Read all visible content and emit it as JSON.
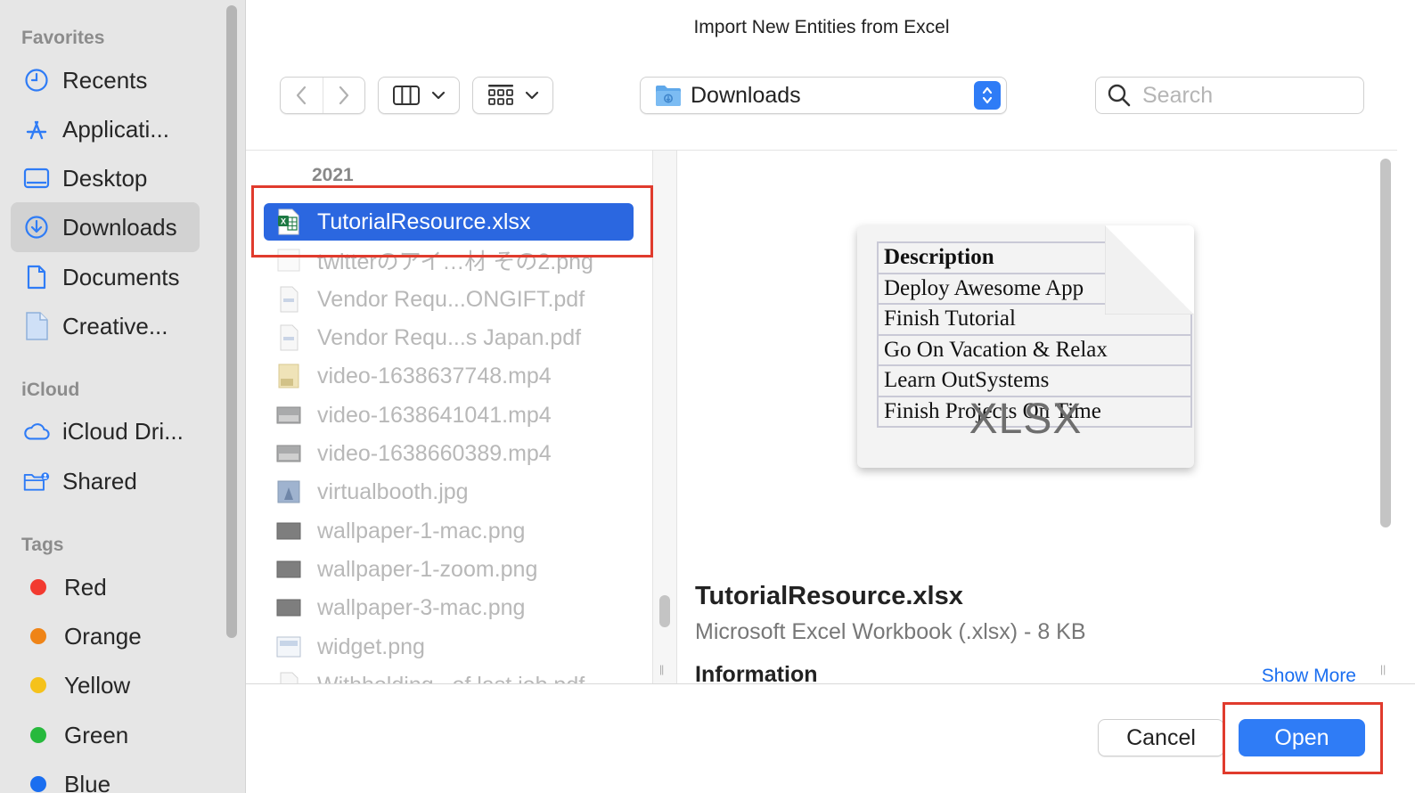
{
  "dialog": {
    "title": "Import New Entities from Excel"
  },
  "sidebar": {
    "favorites_header": "Favorites",
    "favorites": [
      {
        "label": "Recents",
        "icon": "clock-icon"
      },
      {
        "label": "Applicati...",
        "icon": "applications-icon"
      },
      {
        "label": "Desktop",
        "icon": "desktop-icon"
      },
      {
        "label": "Downloads",
        "icon": "downloads-icon",
        "active": true
      },
      {
        "label": "Documents",
        "icon": "document-icon"
      },
      {
        "label": "Creative...",
        "icon": "file-icon"
      }
    ],
    "icloud_header": "iCloud",
    "icloud": [
      {
        "label": "iCloud Dri...",
        "icon": "cloud-icon"
      },
      {
        "label": "Shared",
        "icon": "shared-folder-icon"
      }
    ],
    "tags_header": "Tags",
    "tags": [
      {
        "label": "Red",
        "color": "#f23a30"
      },
      {
        "label": "Orange",
        "color": "#ef8417"
      },
      {
        "label": "Yellow",
        "color": "#f5c21b"
      },
      {
        "label": "Green",
        "color": "#27b93d"
      },
      {
        "label": "Blue",
        "color": "#1a6ef0"
      }
    ]
  },
  "toolbar": {
    "location": "Downloads",
    "search_placeholder": "Search"
  },
  "file_list": {
    "group_header": "2021",
    "files": [
      {
        "name": "TutorialResource.xlsx",
        "icon": "excel-file-icon",
        "selected": true
      },
      {
        "name": "twitterのアイ…材 その2.png",
        "icon": "image-file-icon"
      },
      {
        "name": "Vendor Requ...ONGIFT.pdf",
        "icon": "pdf-file-icon"
      },
      {
        "name": "Vendor Requ...s Japan.pdf",
        "icon": "pdf-file-icon"
      },
      {
        "name": "video-1638637748.mp4",
        "icon": "video-file-icon"
      },
      {
        "name": "video-1638641041.mp4",
        "icon": "video-file-icon"
      },
      {
        "name": "video-1638660389.mp4",
        "icon": "video-file-icon"
      },
      {
        "name": "virtualbooth.jpg",
        "icon": "image-file-icon"
      },
      {
        "name": "wallpaper-1-mac.png",
        "icon": "image-file-icon"
      },
      {
        "name": "wallpaper-1-zoom.png",
        "icon": "image-file-icon"
      },
      {
        "name": "wallpaper-3-mac.png",
        "icon": "image-file-icon"
      },
      {
        "name": "widget.png",
        "icon": "image-file-icon"
      },
      {
        "name": "Withholding...of last job.pdf",
        "icon": "pdf-file-icon"
      }
    ]
  },
  "preview": {
    "thumbnail_rows": [
      "Description",
      "Deploy Awesome App",
      "Finish Tutorial",
      "Go On Vacation & Relax",
      "Learn OutSystems",
      "Finish Projects On Time"
    ],
    "thumbnail_badge": "XLSX",
    "file_name": "TutorialResource.xlsx",
    "file_kind": "Microsoft Excel Workbook (.xlsx) - 8 KB",
    "info_header": "Information",
    "show_more": "Show More"
  },
  "buttons": {
    "cancel": "Cancel",
    "open": "Open"
  },
  "colors": {
    "accent": "#2f7cf6",
    "selection": "#2b67e0",
    "highlight_box": "#e03b2d"
  }
}
